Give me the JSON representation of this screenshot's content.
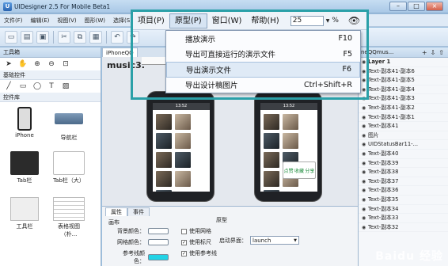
{
  "window": {
    "title": "UIDesigner 2.5 For Mobile Beta1",
    "app_icon": "U",
    "minimize": "–",
    "maximize": "□",
    "close": "×"
  },
  "menubar": [
    "文件(F)",
    "编辑(E)",
    "视图(V)",
    "图形(W)",
    "选择(S)"
  ],
  "toolbar_icons": [
    "new-file-icon",
    "open-folder-icon",
    "save-icon",
    "cut-icon",
    "copy-icon",
    "paste-icon",
    "undo-icon",
    "redo-icon"
  ],
  "left_panel": {
    "title": "工具箱",
    "section_basic": "基础控件",
    "section_controls": "控件库",
    "controls": [
      {
        "label": "iPhone"
      },
      {
        "label": "导航栏"
      },
      {
        "label": "Tab栏"
      },
      {
        "label": "Tab栏（大）"
      },
      {
        "label": "工具栏"
      },
      {
        "label": "表格视图（朴..."
      }
    ]
  },
  "canvas": {
    "doc_tab": "iPhoneQQ",
    "canvas_label": "music3.",
    "phone_left": {
      "header": "13:52",
      "captions": [
        "胆量星",
        "爱情",
        "Wangling",
        "",
        "",
        "",
        "",
        "",
        ""
      ]
    },
    "phone_right": {
      "header": "13:52",
      "captions": [
        "胆量星",
        "爱情",
        "Wangling"
      ]
    },
    "popup": [
      "点赞",
      "收藏",
      "分享"
    ]
  },
  "zoom_menu": {
    "items": [
      "项目(P)",
      "原型(P)",
      "窗口(W)",
      "帮助(H)"
    ],
    "active_index": 1,
    "zoom_value": "25",
    "zoom_unit": "%",
    "dropdown": [
      {
        "label": "播放演示",
        "shortcut": "F10"
      },
      {
        "label": "导出可直接运行的演示文件",
        "shortcut": "F5"
      },
      {
        "label": "导出演示文件",
        "shortcut": "F6"
      },
      {
        "label": "导出设计稿图片",
        "shortcut": "Ctrl+Shift+R"
      }
    ],
    "hover_index": 2
  },
  "right_panel": {
    "title": "neQQmus...",
    "layer_root": "Layer 1",
    "layers": [
      "Text-副本41-副本6",
      "Text-副本41-副本5",
      "Text-副本41-副本4",
      "Text-副本41-副本3",
      "Text-副本41-副本2",
      "Text-副本41-副本1",
      "Text-副本41",
      "图片",
      "UIDStatusBar11-...",
      "Text-副本40",
      "Text-副本39",
      "Text-副本38",
      "Text-副本37",
      "Text-副本36",
      "Text-副本35",
      "Text-副本34",
      "Text-副本33",
      "Text-副本32"
    ]
  },
  "props": {
    "tabs": [
      "属性",
      "事件"
    ],
    "canvas_title": "画布",
    "bg_color": "背景颜色：",
    "grid_color": "网格颜色：",
    "ref_color": "参考线颜色：",
    "use_grid": "使用网格",
    "use_ruler": "使用标尺",
    "use_ref": "使用参考线",
    "prototype_title": "原型",
    "start_screen_label": "启动界面：",
    "start_screen_value": "launch"
  },
  "watermark": "Baidu 经验",
  "colors": {
    "highlight": "#2aa0a8"
  }
}
